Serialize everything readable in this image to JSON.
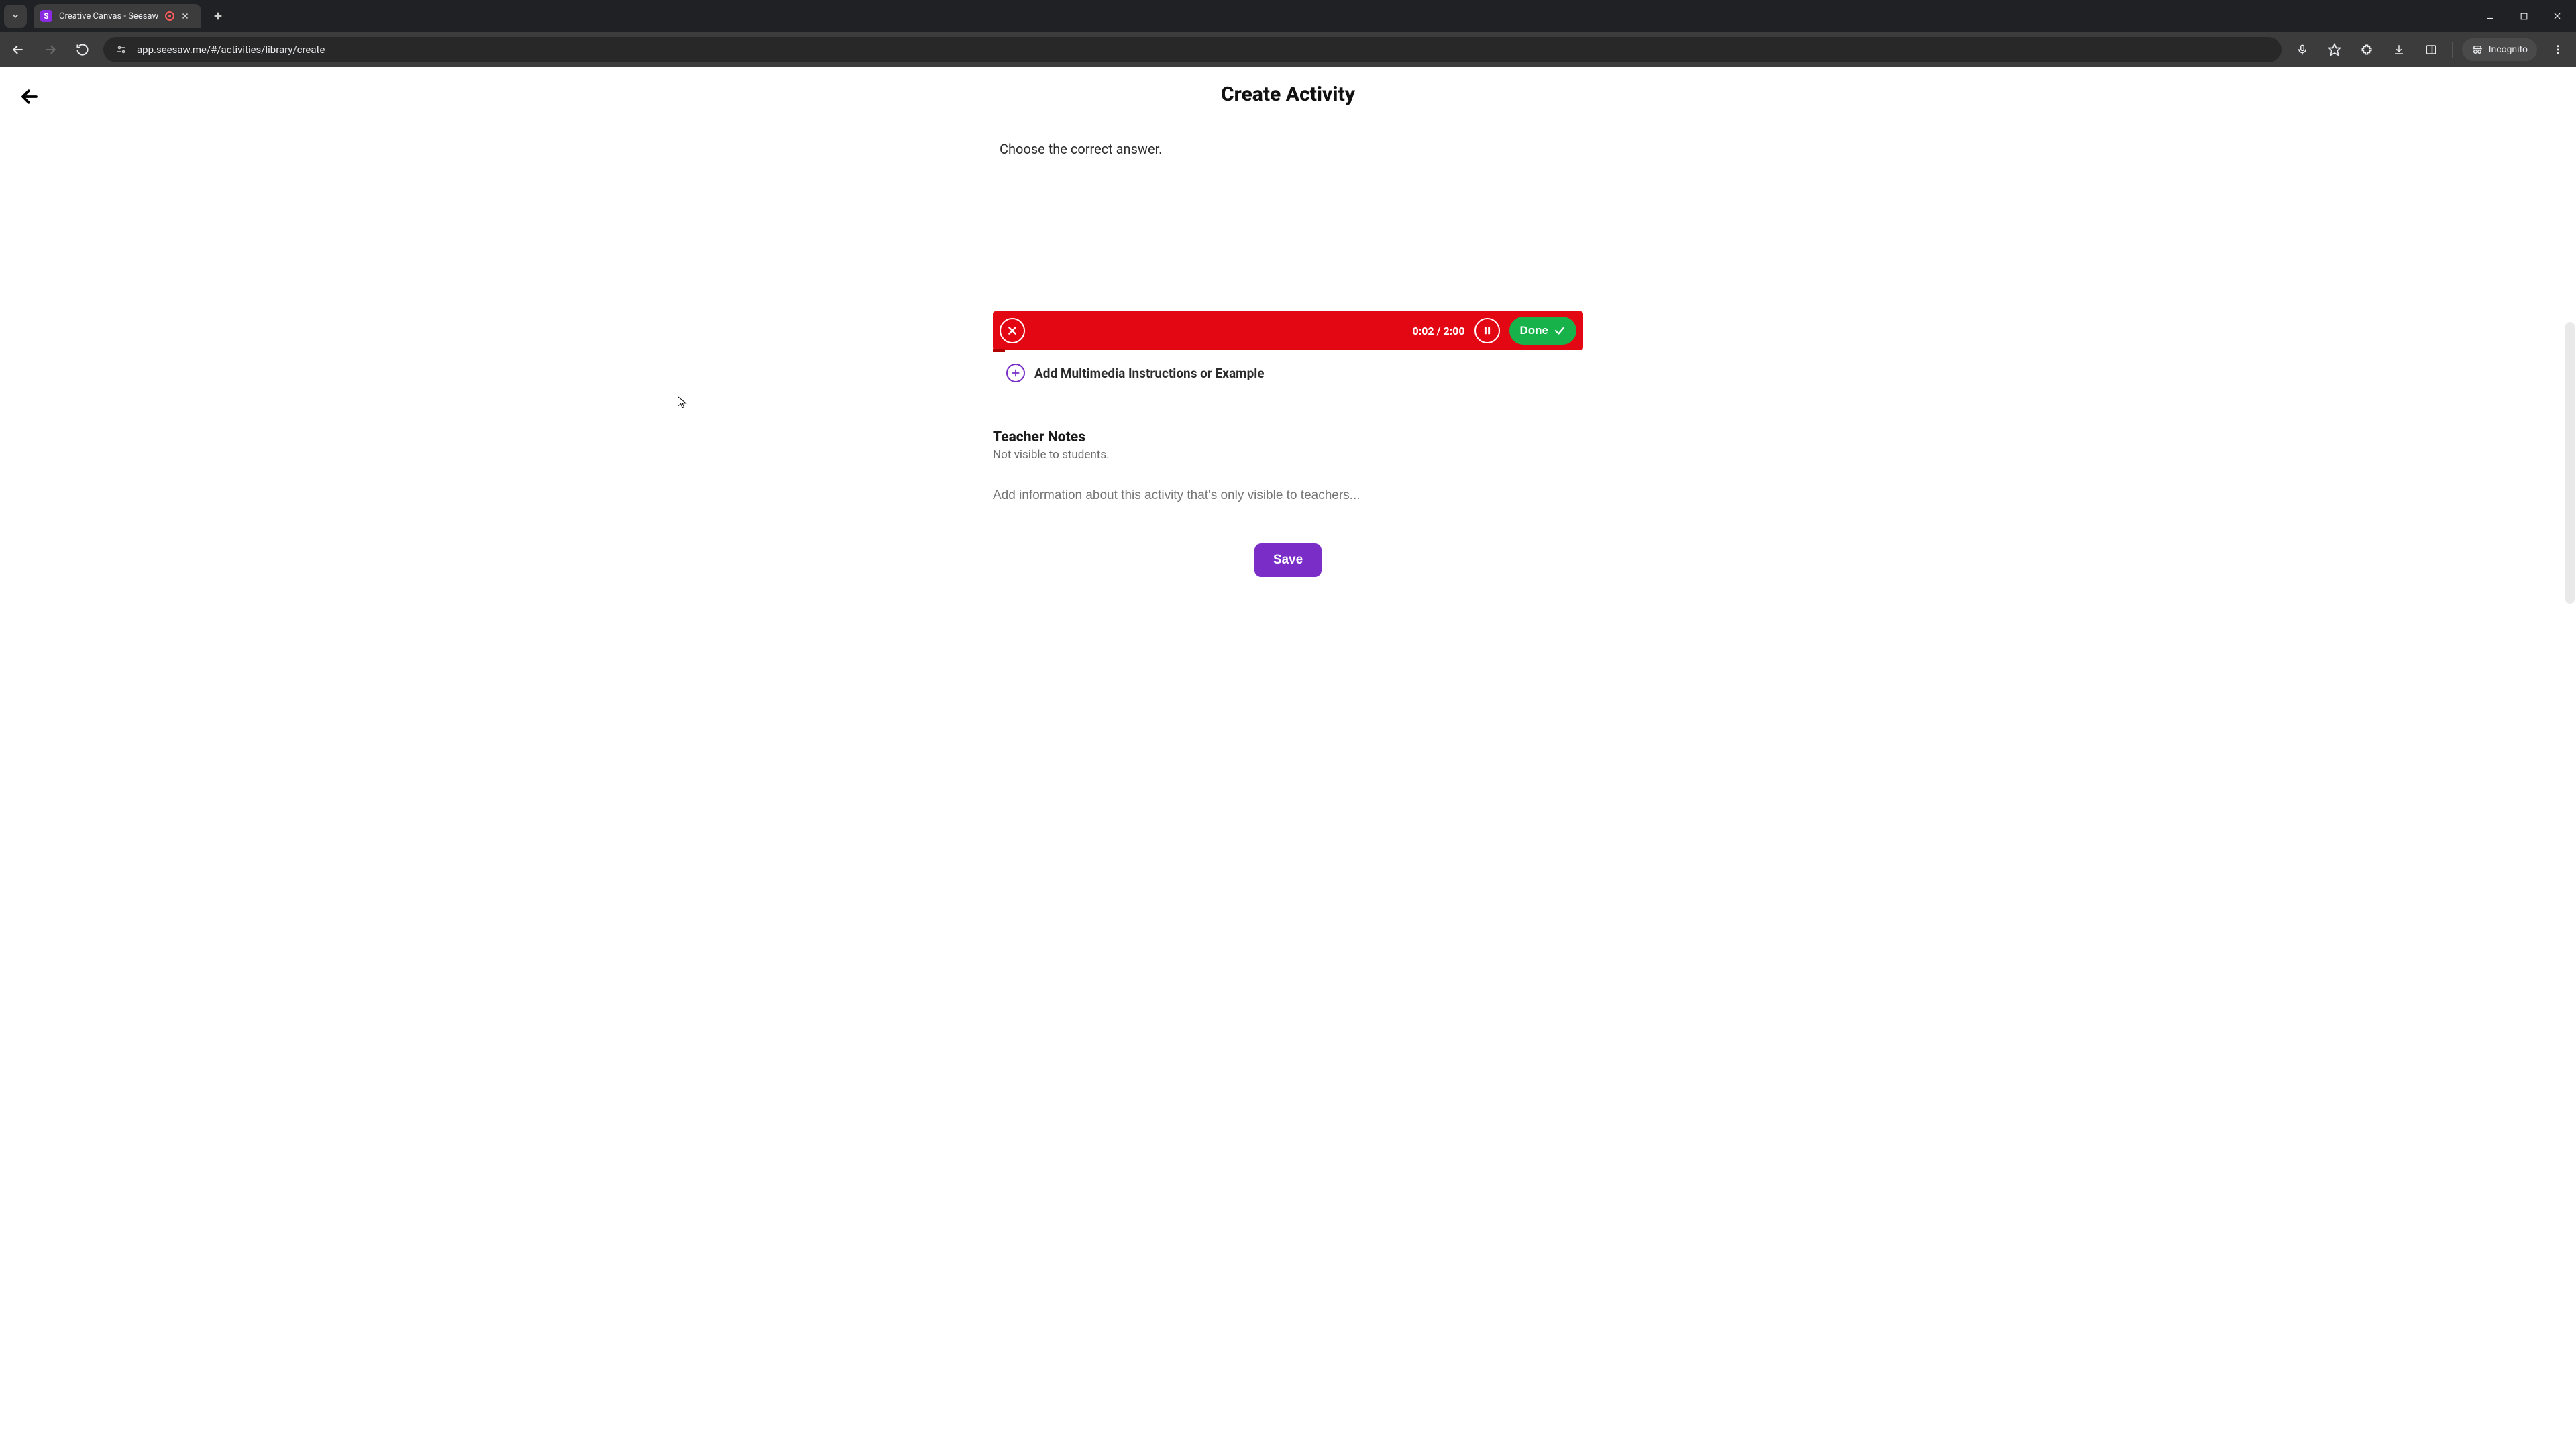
{
  "browser": {
    "tab_title": "Creative Canvas - Seesaw",
    "url": "app.seesaw.me/#/activities/library/create",
    "incognito_label": "Incognito"
  },
  "header": {
    "title": "Create Activity"
  },
  "instruction": {
    "text": "Choose the correct answer."
  },
  "recording": {
    "time": "0:02 / 2:00",
    "done_label": "Done"
  },
  "multimedia": {
    "label": "Add Multimedia Instructions or Example"
  },
  "teacher_notes": {
    "title": "Teacher Notes",
    "subtitle": "Not visible to students.",
    "placeholder": "Add information about this activity that's only visible to teachers..."
  },
  "footer": {
    "save_label": "Save"
  }
}
